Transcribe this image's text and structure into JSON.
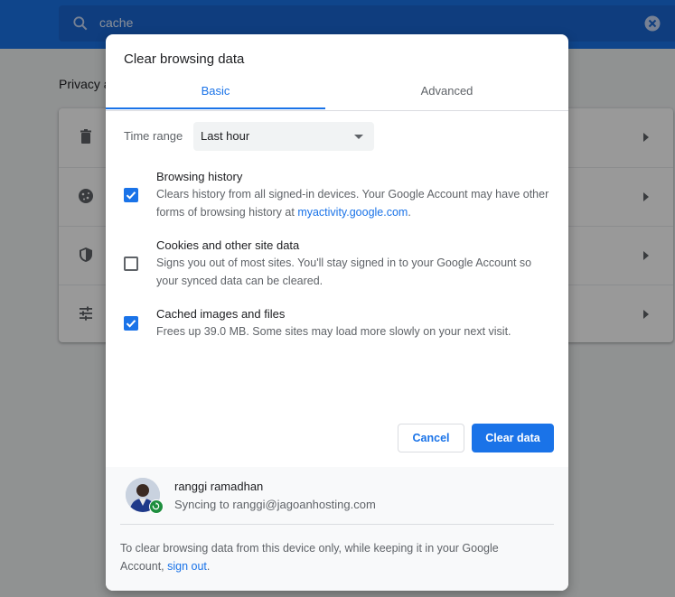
{
  "background": {
    "search": {
      "value": "cache"
    },
    "section_title": "Privacy a"
  },
  "dialog": {
    "title": "Clear browsing data",
    "tabs": [
      {
        "label": "Basic",
        "active": true
      },
      {
        "label": "Advanced",
        "active": false
      }
    ],
    "time_range": {
      "label": "Time range",
      "selected": "Last hour"
    },
    "options": [
      {
        "title": "Browsing history",
        "checked": true,
        "desc_prefix": "Clears history from all signed-in devices. Your Google Account may have other forms of browsing history at ",
        "desc_link": "myactivity.google.com",
        "desc_suffix": "."
      },
      {
        "title": "Cookies and other site data",
        "checked": false,
        "desc": "Signs you out of most sites. You'll stay signed in to your Google Account so your synced data can be cleared."
      },
      {
        "title": "Cached images and files",
        "checked": true,
        "desc": "Frees up 39.0 MB. Some sites may load more slowly on your next visit."
      }
    ],
    "buttons": {
      "cancel": "Cancel",
      "clear": "Clear data"
    },
    "account": {
      "name": "ranggi ramadhan",
      "sync_text": "Syncing to ranggi@jagoanhosting.com"
    },
    "footer_note": {
      "prefix": "To clear browsing data from this device only, while keeping it in your Google Account, ",
      "link": "sign out",
      "suffix": "."
    }
  },
  "colors": {
    "accent": "#1a73e8",
    "header": "#1a73e8",
    "sync_badge": "#1e8e3e"
  }
}
